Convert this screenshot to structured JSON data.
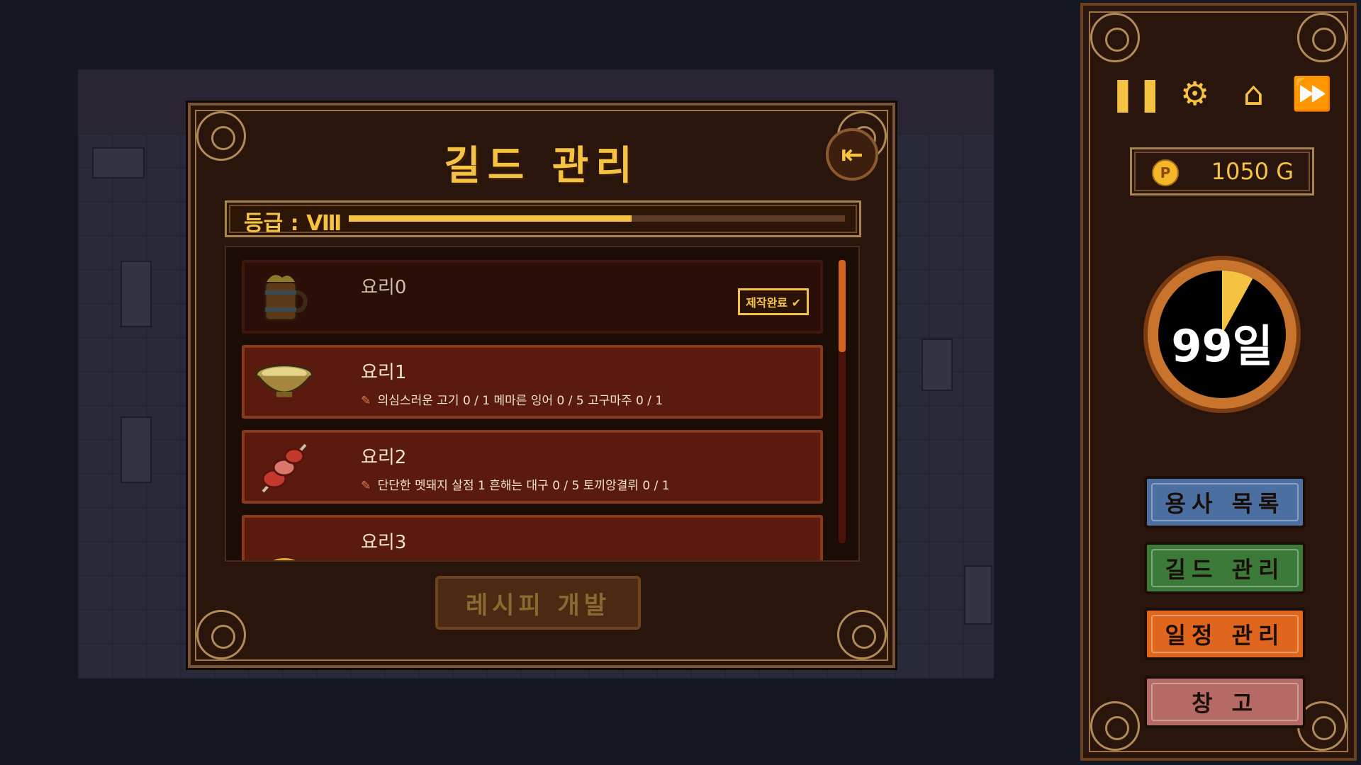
{
  "dialog": {
    "title": "길드 관리",
    "exit_icon": "exit-door-icon",
    "grade_label": "등급 : Ⅷ",
    "grade_progress": 0.57,
    "recipe_button": "레시피 개발"
  },
  "recipes": [
    {
      "name": "요리0",
      "icon": "wooden-mug-icon",
      "status": "done",
      "badge": "제작완료",
      "ingredients": []
    },
    {
      "name": "요리1",
      "icon": "bowl-icon",
      "status": "pending",
      "ingredients_text": "의심스러운 고기 0 / 1 메마른 잉어 0 / 5   고구마주 0 / 1"
    },
    {
      "name": "요리2",
      "icon": "meat-skewer-icon",
      "status": "pending",
      "ingredients_text": "단단한 멧돼지 살점 1 흔해는 대구 0 / 5 토끼앙결뤼 0 / 1"
    },
    {
      "name": "요리3",
      "icon": "food-icon",
      "status": "pending",
      "ingredients_text": ""
    }
  ],
  "sidebar": {
    "icons": [
      "pause-icon",
      "settings-gear-icon",
      "home-icon",
      "fast-forward-icon"
    ],
    "gold": "1050 G",
    "coin_symbol": "P",
    "day": "99일",
    "day_progress": 0.08,
    "buttons": [
      {
        "label": "용사 목록",
        "color": "#4a6fa0"
      },
      {
        "label": "길드 관리",
        "color": "#3c7a3a"
      },
      {
        "label": "일정 관리",
        "color": "#e0661e"
      },
      {
        "label": "창 고",
        "color": "#b56a66"
      }
    ]
  }
}
